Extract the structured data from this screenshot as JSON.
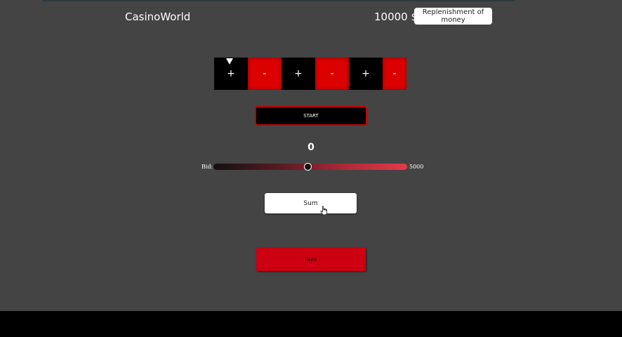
{
  "header": {
    "brand": "CasinoWorld",
    "balance": "10000 $",
    "replenish_label": "Replenishment of money"
  },
  "roulette": {
    "cells": [
      {
        "symbol": "+",
        "color": "black"
      },
      {
        "symbol": "-",
        "color": "red"
      },
      {
        "symbol": "+",
        "color": "black"
      },
      {
        "symbol": "-",
        "color": "red"
      },
      {
        "symbol": "+",
        "color": "black"
      },
      {
        "symbol": "-",
        "color": "red"
      }
    ],
    "pointer_icon": "triangle-down-icon"
  },
  "controls": {
    "start_label": "START",
    "result": "0",
    "bid_label": "Bid:",
    "bid_max": "5000",
    "bid_fraction": 0.49,
    "sum_label": "Sum",
    "rule_label": "Rule"
  },
  "colors": {
    "background": "#444444",
    "red": "#dd0000",
    "black": "#000000",
    "slider_end": "#e4394a"
  }
}
